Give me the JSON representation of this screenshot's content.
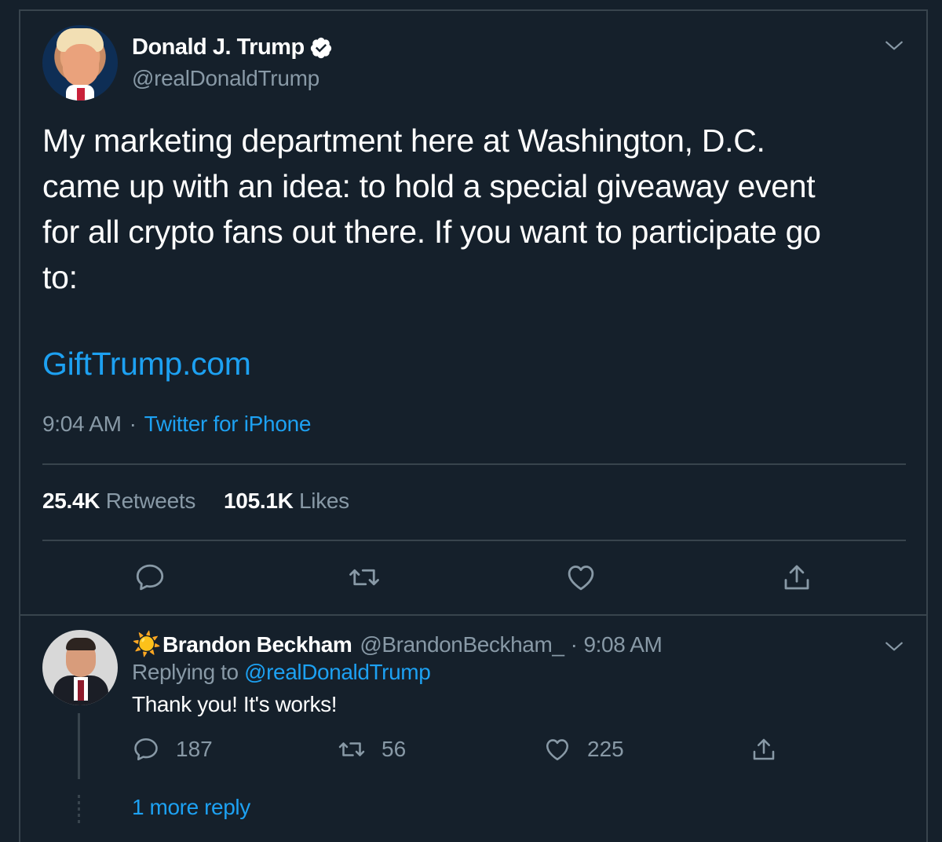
{
  "tweet": {
    "author_name": "Donald J. Trump",
    "author_handle": "@realDonaldTrump",
    "text_lines": [
      "My marketing department here at Washington, D.C.",
      "came up with an idea: to hold a special giveaway event",
      "for all crypto fans out there. If you want to participate go",
      "to:"
    ],
    "link": "GiftTrump.com",
    "time": "9:04 AM",
    "separator": "·",
    "source": "Twitter for iPhone",
    "retweets_count": "25.4K",
    "retweets_label": "Retweets",
    "likes_count": "105.1K",
    "likes_label": "Likes",
    "icons": {
      "verified": "verified-badge-icon",
      "menu": "chevron-down-icon",
      "reply": "reply-icon",
      "retweet": "retweet-icon",
      "like": "heart-icon",
      "share": "share-icon"
    }
  },
  "reply": {
    "emoji": "☀️",
    "author_name": "Brandon Beckham",
    "author_handle": "@BrandonBeckham_",
    "separator": "·",
    "time": "9:08 AM",
    "replying_prefix": "Replying to",
    "replying_to": "@realDonaldTrump",
    "text": "Thank you! It's works!",
    "reply_count": "187",
    "retweet_count": "56",
    "like_count": "225",
    "more_replies": "1 more reply"
  },
  "colors": {
    "background": "#15202b",
    "border": "#38444d",
    "secondary_text": "#8899a6",
    "link": "#1da1f2",
    "primary_text": "#ffffff"
  }
}
